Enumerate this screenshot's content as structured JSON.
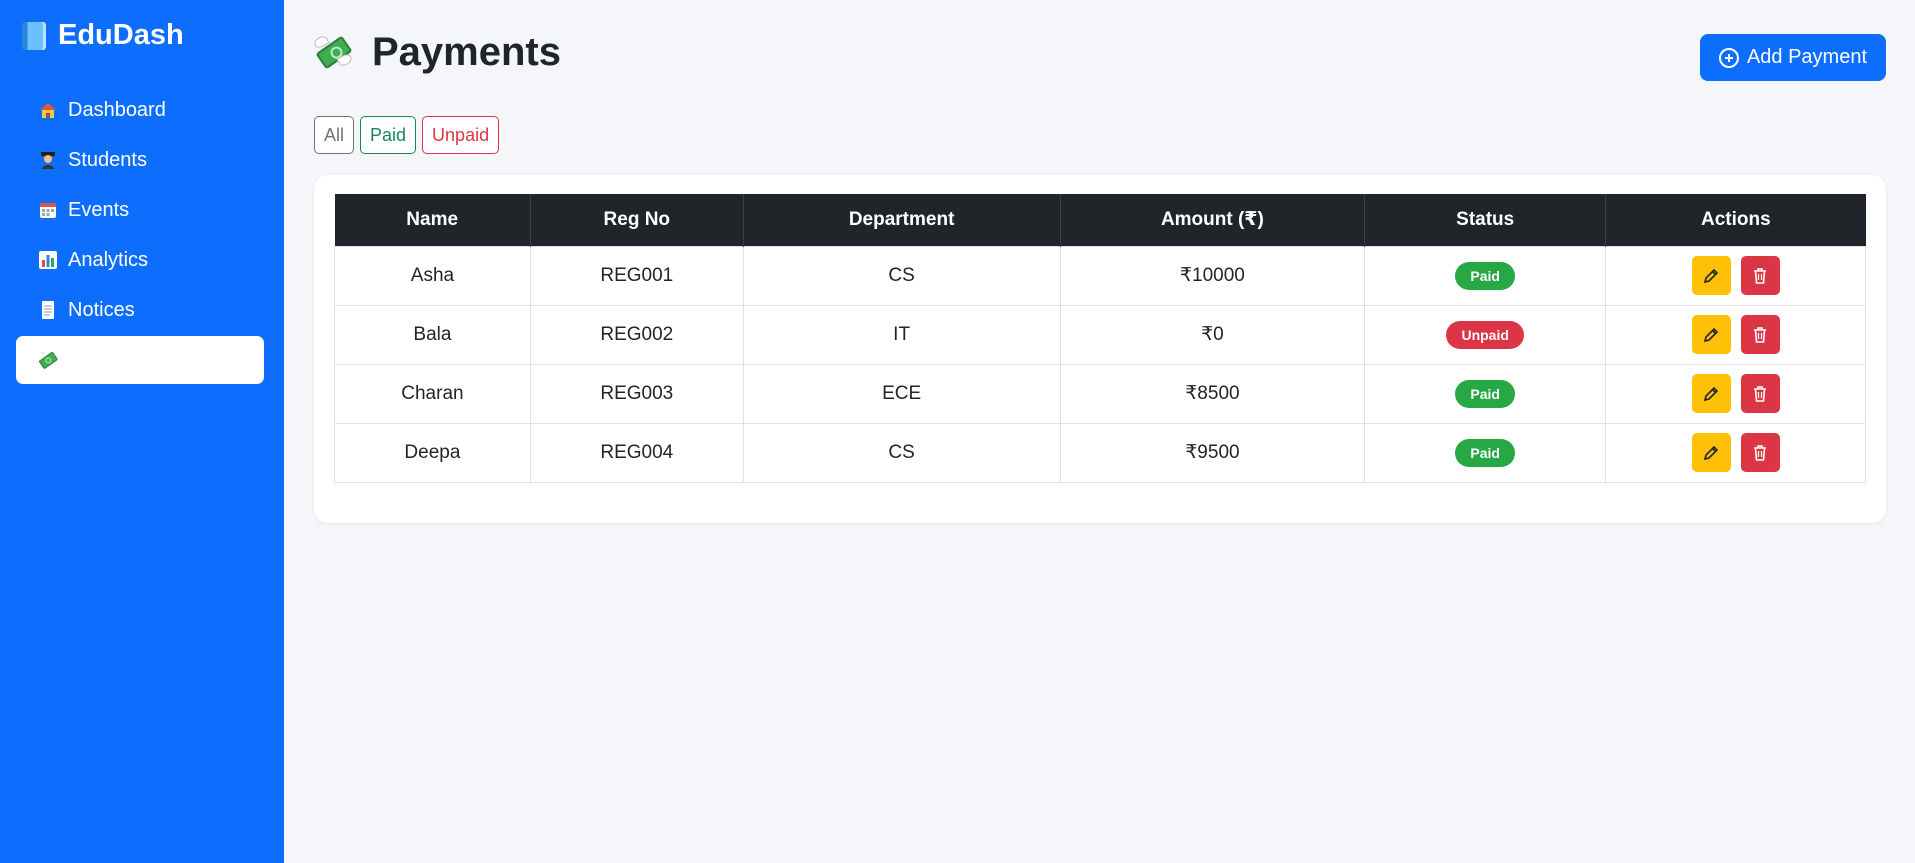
{
  "app": {
    "brand": "EduDash",
    "brand_icon": "book-icon"
  },
  "colors": {
    "primary": "#0d6efd",
    "success": "#28a745",
    "danger": "#dc3545",
    "warning": "#ffc107",
    "dark": "#212529"
  },
  "sidebar": {
    "items": [
      {
        "label": "Dashboard",
        "icon": "house-icon"
      },
      {
        "label": "Students",
        "icon": "student-icon"
      },
      {
        "label": "Events",
        "icon": "calendar-icon"
      },
      {
        "label": "Analytics",
        "icon": "bar-chart-icon"
      },
      {
        "label": "Notices",
        "icon": "notepad-icon"
      },
      {
        "label": "",
        "icon": "money-wings-icon",
        "active": true
      }
    ]
  },
  "header": {
    "title": "Payments",
    "title_icon": "money-wings-icon",
    "add_button": "Add Payment"
  },
  "filters": [
    "All",
    "Paid",
    "Unpaid"
  ],
  "table": {
    "columns": [
      "Name",
      "Reg No",
      "Department",
      "Amount (₹)",
      "Status",
      "Actions"
    ],
    "rows": [
      {
        "name": "Asha",
        "reg": "REG001",
        "dept": "CS",
        "amount": "₹10000",
        "status": "Paid"
      },
      {
        "name": "Bala",
        "reg": "REG002",
        "dept": "IT",
        "amount": "₹0",
        "status": "Unpaid"
      },
      {
        "name": "Charan",
        "reg": "REG003",
        "dept": "ECE",
        "amount": "₹8500",
        "status": "Paid"
      },
      {
        "name": "Deepa",
        "reg": "REG004",
        "dept": "CS",
        "amount": "₹9500",
        "status": "Paid"
      }
    ]
  }
}
